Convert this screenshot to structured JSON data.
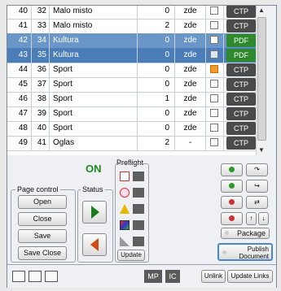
{
  "rows": [
    {
      "num": "40",
      "page": "32",
      "name": "Malo misto",
      "count": "0",
      "status": "zde",
      "checkbox": "unchecked",
      "tag": "CTP",
      "selected": ""
    },
    {
      "num": "41",
      "page": "33",
      "name": "Malo misto",
      "count": "2",
      "status": "zde",
      "checkbox": "unchecked",
      "tag": "CTP",
      "selected": ""
    },
    {
      "num": "42",
      "page": "34",
      "name": "Kultura",
      "count": "0",
      "status": "zde",
      "checkbox": "unchecked",
      "tag": "PDF",
      "selected": "sel"
    },
    {
      "num": "43",
      "page": "35",
      "name": "Kultura",
      "count": "0",
      "status": "zde",
      "checkbox": "checked",
      "tag": "PDF",
      "selected": "sel2"
    },
    {
      "num": "44",
      "page": "36",
      "name": "Sport",
      "count": "0",
      "status": "zde",
      "checkbox": "orange",
      "tag": "CTP",
      "selected": ""
    },
    {
      "num": "45",
      "page": "37",
      "name": "Sport",
      "count": "0",
      "status": "zde",
      "checkbox": "unchecked",
      "tag": "CTP",
      "selected": ""
    },
    {
      "num": "46",
      "page": "38",
      "name": "Sport",
      "count": "1",
      "status": "zde",
      "checkbox": "unchecked",
      "tag": "CTP",
      "selected": ""
    },
    {
      "num": "47",
      "page": "39",
      "name": "Sport",
      "count": "0",
      "status": "zde",
      "checkbox": "unchecked",
      "tag": "CTP",
      "selected": ""
    },
    {
      "num": "48",
      "page": "40",
      "name": "Sport",
      "count": "0",
      "status": "zde",
      "checkbox": "unchecked",
      "tag": "CTP",
      "selected": ""
    },
    {
      "num": "49",
      "page": "41",
      "name": "Oglas",
      "count": "2",
      "status": "-",
      "checkbox": "unchecked",
      "tag": "CTP",
      "selected": ""
    }
  ],
  "status_on": "ON",
  "preflight_label": "Preflight",
  "page_control": {
    "label": "Page control",
    "open": "Open",
    "close": "Close",
    "save": "Save",
    "save_close": "Save Close"
  },
  "status_label": "Status",
  "update": "Update",
  "package": "Package",
  "publish": "Publish Document",
  "bottom": {
    "mp": "MP",
    "ic": "IC",
    "unlink": "Unlink",
    "update_links": "Update Links"
  },
  "colors": {
    "on_green": "#1e8a1e",
    "selection": "#6a96c8",
    "pdf_green": "#2f8a2f",
    "ctp_dark": "#4a4a4a",
    "orange": "#f39a2c"
  }
}
